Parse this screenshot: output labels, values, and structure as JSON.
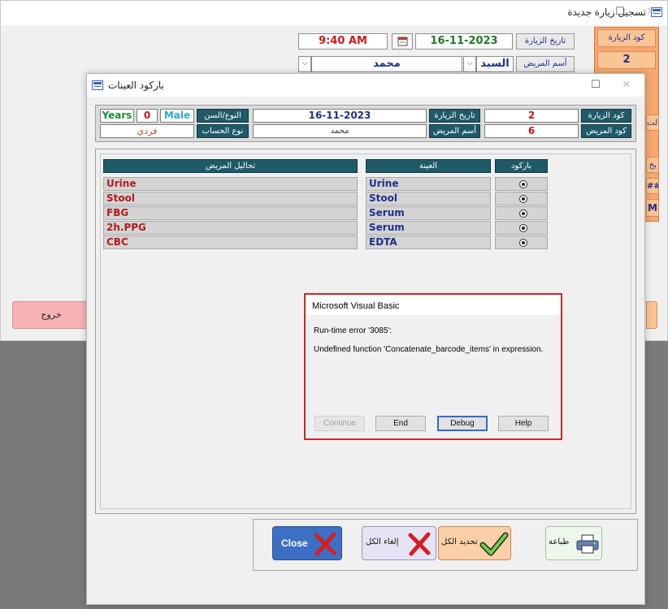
{
  "background_window": {
    "title": "تسجيل زيارة جديدة",
    "visit_date_label": "تاريخ الزيارة",
    "visit_date": "16-11-2023",
    "visit_time": "9:40 AM",
    "patient_name_label": "أسم المريض",
    "salutation": "السيد",
    "patient_name": "محمد",
    "visit_code_label": "كود الزيارة",
    "visit_code": "2",
    "exit_label": "خروج",
    "side_fragments": [
      "الت",
      "يخ",
      "##",
      "M"
    ]
  },
  "main_window": {
    "title": "باركود العينات",
    "header": {
      "visit_code_label": "كود الزيارة",
      "visit_code": "2",
      "patient_code_label": "كود المريض",
      "patient_code": "6",
      "visit_date_label": "تاريخ الزيارة",
      "visit_date": "16-11-2023",
      "patient_name_label": "أسم المريض",
      "patient_name": "محمد",
      "gender_age_label": "النوع/السن",
      "gender": "Male",
      "age": "0",
      "age_unit": "Years",
      "account_type_label": "نوع الحساب",
      "account_type": "فردي"
    },
    "columns": {
      "barcode": "باركود",
      "sample": "العينة",
      "tests": "تحاليل المريض"
    },
    "rows": [
      {
        "sample": "Urine",
        "test": "Urine"
      },
      {
        "sample": "Stool",
        "test": "Stool"
      },
      {
        "sample": "Serum",
        "test": "FBG"
      },
      {
        "sample": "Serum",
        "test": "2h.PPG"
      },
      {
        "sample": "EDTA",
        "test": "CBC"
      }
    ],
    "buttons": {
      "close": "Close",
      "cancel_all": "إلغاء الكل",
      "select_all": "تحديد الكل",
      "print": "طباعة"
    }
  },
  "dialog": {
    "title": "Microsoft Visual Basic",
    "error_line": "Run-time error '3085':",
    "message": "Undefined function 'Concatenate_barcode_items' in expression.",
    "buttons": {
      "continue": "Continue",
      "end": "End",
      "debug": "Debug",
      "help": "Help"
    }
  },
  "colors": {
    "teal_label": "#1f5a68",
    "test_text": "#b01c1c",
    "sample_text": "#1f2f8a",
    "error_border": "#c8282c",
    "orange_cell": "#fbc495",
    "close_button": "#3d6fc4",
    "cancel_button": "#e6e3f5",
    "select_button": "#fbd0a8",
    "print_button": "#eef7ec"
  },
  "icons": [
    "form-icon",
    "calendar-icon",
    "x-mark-icon",
    "checkmark-icon",
    "printer-icon"
  ]
}
